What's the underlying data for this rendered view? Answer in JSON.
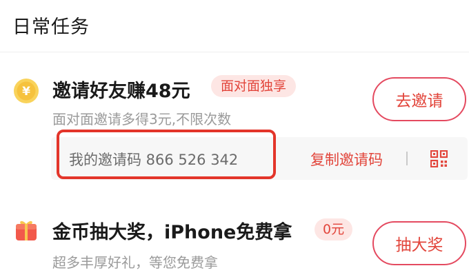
{
  "section": {
    "title": "日常任务"
  },
  "tasks": [
    {
      "icon": "coin-icon",
      "title": "邀请好友赚48元",
      "tag": "面对面独享",
      "subtitle": "面对面邀请多得3元,不限次数",
      "button": "去邀请",
      "coin_symbol": "¥",
      "invite_code": {
        "text": "我的邀请码 866 526 342",
        "copy_label": "复制邀请码",
        "qr_icon": "qr-code-icon"
      }
    },
    {
      "icon": "gift-icon",
      "title": "金币抽大奖，iPhone免费拿",
      "tag": "0元",
      "subtitle": "超多丰厚好礼，等您免费拿",
      "button": "抽大奖"
    }
  ],
  "colors": {
    "accent": "#e2453b",
    "tag_bg": "#fde6e4",
    "coin": "#f6c23d",
    "gift": "#f2594b",
    "highlight_border": "#e3352a"
  }
}
